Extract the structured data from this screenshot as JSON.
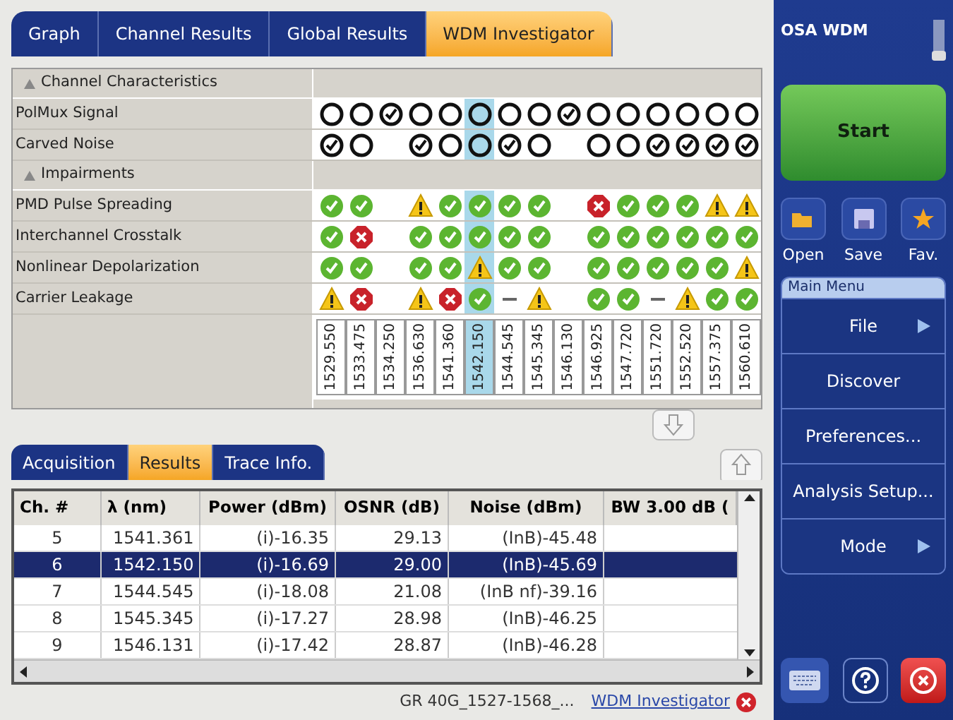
{
  "top_tabs": [
    {
      "label": "Graph",
      "selected": false
    },
    {
      "label": "Channel Results",
      "selected": false
    },
    {
      "label": "Global Results",
      "selected": false
    },
    {
      "label": "WDM Investigator",
      "selected": true
    }
  ],
  "grid": {
    "sections": [
      {
        "title": "Channel Characteristics",
        "expanded": true,
        "rows": [
          {
            "label": "PolMux Signal",
            "cells": [
              {
                "kind": "ring",
                "checked": false
              },
              {
                "kind": "ring",
                "checked": false
              },
              {
                "kind": "ring",
                "checked": true
              },
              {
                "kind": "ring",
                "checked": false
              },
              {
                "kind": "ring",
                "checked": false
              },
              {
                "kind": "ring",
                "checked": false
              },
              {
                "kind": "ring",
                "checked": false
              },
              {
                "kind": "ring",
                "checked": false
              },
              {
                "kind": "ring",
                "checked": true
              },
              {
                "kind": "ring",
                "checked": false
              },
              {
                "kind": "ring",
                "checked": false
              },
              {
                "kind": "ring",
                "checked": false
              },
              {
                "kind": "ring",
                "checked": false
              },
              {
                "kind": "ring",
                "checked": false
              },
              {
                "kind": "ring",
                "checked": false
              }
            ]
          },
          {
            "label": "Carved Noise",
            "cells": [
              {
                "kind": "ring",
                "checked": true
              },
              {
                "kind": "ring",
                "checked": false
              },
              {
                "kind": "blank"
              },
              {
                "kind": "ring",
                "checked": true
              },
              {
                "kind": "ring",
                "checked": false
              },
              {
                "kind": "ring",
                "checked": false
              },
              {
                "kind": "ring",
                "checked": true
              },
              {
                "kind": "ring",
                "checked": false
              },
              {
                "kind": "blank"
              },
              {
                "kind": "ring",
                "checked": false
              },
              {
                "kind": "ring",
                "checked": false
              },
              {
                "kind": "ring",
                "checked": true
              },
              {
                "kind": "ring",
                "checked": true
              },
              {
                "kind": "ring",
                "checked": true
              },
              {
                "kind": "ring",
                "checked": true
              }
            ]
          }
        ]
      },
      {
        "title": "Impairments",
        "expanded": true,
        "rows": [
          {
            "label": "PMD Pulse Spreading",
            "cells": [
              {
                "kind": "pass"
              },
              {
                "kind": "pass"
              },
              {
                "kind": "blank"
              },
              {
                "kind": "warning"
              },
              {
                "kind": "pass"
              },
              {
                "kind": "pass"
              },
              {
                "kind": "pass"
              },
              {
                "kind": "pass"
              },
              {
                "kind": "blank"
              },
              {
                "kind": "fail"
              },
              {
                "kind": "pass"
              },
              {
                "kind": "pass"
              },
              {
                "kind": "pass"
              },
              {
                "kind": "warning"
              },
              {
                "kind": "warning"
              }
            ]
          },
          {
            "label": "Interchannel Crosstalk",
            "cells": [
              {
                "kind": "pass"
              },
              {
                "kind": "fail"
              },
              {
                "kind": "blank"
              },
              {
                "kind": "pass"
              },
              {
                "kind": "pass"
              },
              {
                "kind": "pass"
              },
              {
                "kind": "pass"
              },
              {
                "kind": "pass"
              },
              {
                "kind": "blank"
              },
              {
                "kind": "pass"
              },
              {
                "kind": "pass"
              },
              {
                "kind": "pass"
              },
              {
                "kind": "pass"
              },
              {
                "kind": "pass"
              },
              {
                "kind": "pass"
              }
            ]
          },
          {
            "label": "Nonlinear Depolarization",
            "cells": [
              {
                "kind": "pass"
              },
              {
                "kind": "pass"
              },
              {
                "kind": "blank"
              },
              {
                "kind": "pass"
              },
              {
                "kind": "pass"
              },
              {
                "kind": "warning"
              },
              {
                "kind": "pass"
              },
              {
                "kind": "pass"
              },
              {
                "kind": "blank"
              },
              {
                "kind": "pass"
              },
              {
                "kind": "pass"
              },
              {
                "kind": "pass"
              },
              {
                "kind": "pass"
              },
              {
                "kind": "pass"
              },
              {
                "kind": "warning"
              }
            ]
          },
          {
            "label": "Carrier Leakage",
            "cells": [
              {
                "kind": "warning"
              },
              {
                "kind": "fail"
              },
              {
                "kind": "blank"
              },
              {
                "kind": "warning"
              },
              {
                "kind": "fail"
              },
              {
                "kind": "pass"
              },
              {
                "kind": "unavailable"
              },
              {
                "kind": "warning"
              },
              {
                "kind": "blank"
              },
              {
                "kind": "pass"
              },
              {
                "kind": "pass"
              },
              {
                "kind": "unavailable"
              },
              {
                "kind": "warning"
              },
              {
                "kind": "pass"
              },
              {
                "kind": "pass"
              }
            ]
          }
        ]
      }
    ],
    "channels": [
      {
        "wavelength": "1529.550",
        "selected": false
      },
      {
        "wavelength": "1533.475",
        "selected": false
      },
      {
        "wavelength": "1534.250",
        "selected": false
      },
      {
        "wavelength": "1536.630",
        "selected": false
      },
      {
        "wavelength": "1541.360",
        "selected": false
      },
      {
        "wavelength": "1542.150",
        "selected": true
      },
      {
        "wavelength": "1544.545",
        "selected": false
      },
      {
        "wavelength": "1545.345",
        "selected": false
      },
      {
        "wavelength": "1546.130",
        "selected": false
      },
      {
        "wavelength": "1546.925",
        "selected": false
      },
      {
        "wavelength": "1547.720",
        "selected": false
      },
      {
        "wavelength": "1551.720",
        "selected": false
      },
      {
        "wavelength": "1552.520",
        "selected": false
      },
      {
        "wavelength": "1557.375",
        "selected": false
      },
      {
        "wavelength": "1560.610",
        "selected": false
      }
    ]
  },
  "bottom_tabs": [
    {
      "label": "Acquisition",
      "selected": false
    },
    {
      "label": "Results",
      "selected": true
    },
    {
      "label": "Trace Info.",
      "selected": false
    }
  ],
  "table": {
    "columns": [
      "Ch. #",
      "λ (nm)",
      "Power (dBm)",
      "OSNR (dB)",
      "Noise (dBm)",
      "BW 3.00 dB ("
    ],
    "rows": [
      {
        "cells": [
          "5",
          "1541.361",
          "(i)-16.35",
          "29.13",
          "(InB)-45.48"
        ],
        "selected": false
      },
      {
        "cells": [
          "6",
          "1542.150",
          "(i)-16.69",
          "29.00",
          "(InB)-45.69"
        ],
        "selected": true
      },
      {
        "cells": [
          "7",
          "1544.545",
          "(i)-18.08",
          "21.08",
          "(InB nf)-39.16"
        ],
        "selected": false
      },
      {
        "cells": [
          "8",
          "1545.345",
          "(i)-17.27",
          "28.98",
          "(InB)-46.25"
        ],
        "selected": false
      },
      {
        "cells": [
          "9",
          "1546.131",
          "(i)-17.42",
          "28.87",
          "(InB)-46.28"
        ],
        "selected": false
      }
    ]
  },
  "status_bar": {
    "file": "GR 40G_1527-1568_...",
    "link": "WDM Investigator"
  },
  "side_panel": {
    "title": "OSA WDM",
    "start": "Start",
    "actions": [
      {
        "kind": "open",
        "label": "Open"
      },
      {
        "kind": "save",
        "label": "Save"
      },
      {
        "kind": "favorite",
        "label": "Fav."
      }
    ],
    "menu_title": "Main Menu",
    "menu": [
      {
        "label": "File",
        "submenu": true
      },
      {
        "label": "Discover",
        "submenu": false
      },
      {
        "label": "Preferences...",
        "submenu": false
      },
      {
        "label": "Analysis Setup...",
        "submenu": false
      },
      {
        "label": "Mode",
        "submenu": true
      }
    ]
  }
}
